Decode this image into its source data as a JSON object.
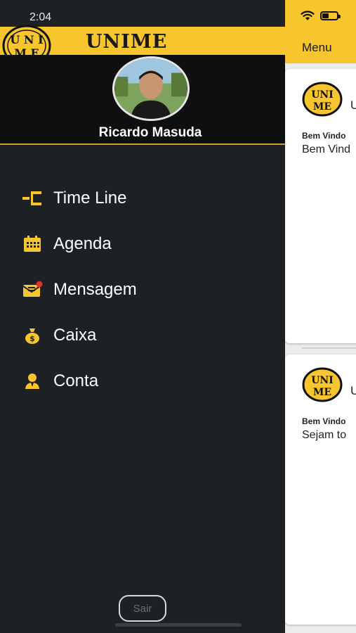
{
  "status_bar": {
    "time": "2:04"
  },
  "app": {
    "menu_label": "Menu",
    "feed": [
      {
        "logo_letter": "U",
        "author": "Bem Vindo",
        "text": "Bem Vind"
      },
      {
        "logo_letter": "U",
        "author": "Bem Vindo",
        "text": "Sejam to"
      }
    ]
  },
  "drawer": {
    "brand": "UNIME",
    "logo_text": {
      "top": "U N I",
      "bottom": "M E"
    },
    "user_name": "Ricardo Masuda",
    "menu": [
      {
        "label": "Time Line",
        "icon": "timeline-icon"
      },
      {
        "label": "Agenda",
        "icon": "calendar-icon"
      },
      {
        "label": "Mensagem",
        "icon": "message-icon"
      },
      {
        "label": "Caixa",
        "icon": "money-bag-icon"
      },
      {
        "label": "Conta",
        "icon": "account-icon"
      }
    ],
    "logout_label": "Sair"
  },
  "colors": {
    "accent_yellow": "#f7c52e",
    "drawer_bg": "#1e2124",
    "profile_bg": "#0e0f10",
    "notification_red": "#e0312b"
  }
}
